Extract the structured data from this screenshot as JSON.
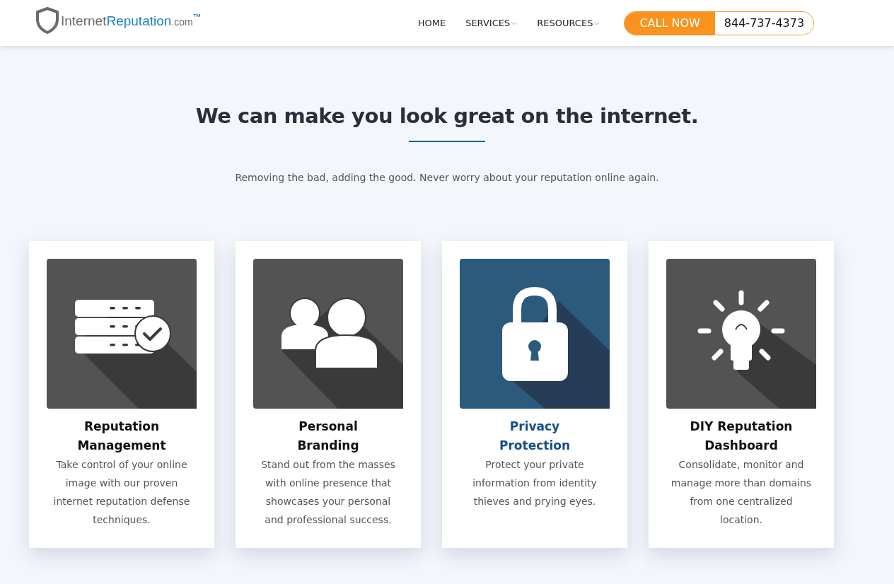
{
  "header": {
    "logo": {
      "main": "Internet",
      "accent": "Reputation",
      "suffix": ".com",
      "mark": "™"
    },
    "nav": [
      {
        "label": "HOME",
        "dropdown": false
      },
      {
        "label": "SERVICES",
        "dropdown": true
      },
      {
        "label": "RESOURCES",
        "dropdown": true
      }
    ],
    "call": {
      "label": "CALL NOW",
      "phone": "844-737-4373"
    }
  },
  "hero": {
    "title": "We can make you look great on the internet.",
    "subtitle": "Removing the bad, adding the good. Never worry about your reputation online again."
  },
  "cards": [
    {
      "kind": "servers",
      "title": "Reputation Management",
      "text": "Take control of your online image with our proven internet reputation defense techniques.",
      "selected": false
    },
    {
      "kind": "people",
      "title": "Personal Branding",
      "text": "Stand out from the masses with online presence that showcases your personal and professional success.",
      "selected": false
    },
    {
      "kind": "lock",
      "title": "Privacy Protection",
      "text": "Protect your private information from identity thieves and prying eyes.",
      "selected": true
    },
    {
      "kind": "bulb",
      "title": "DIY Reputation Dashboard",
      "text": "Consolidate, monitor and manage more than domains from one centralized location.",
      "selected": false
    }
  ]
}
